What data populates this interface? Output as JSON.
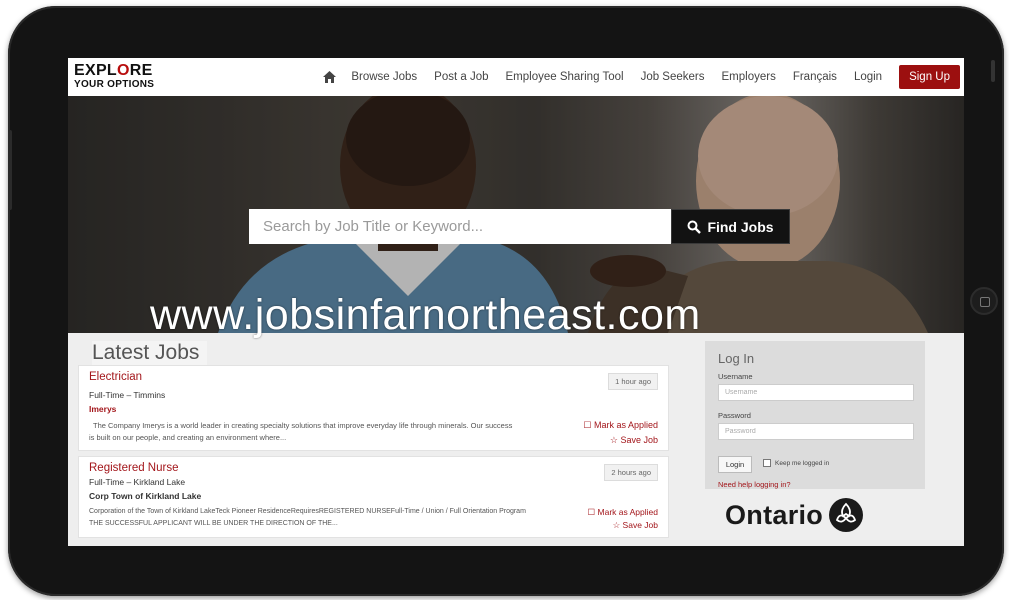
{
  "brand": {
    "line1_a": "EXPL",
    "line1_b": "O",
    "line1_c": "RE",
    "line2": "YOUR OPTIONS",
    "accent_color": "#b80d0d"
  },
  "nav": {
    "home_icon": "home-icon",
    "links": [
      "Browse Jobs",
      "Post a Job",
      "Employee Sharing Tool",
      "Job Seekers",
      "Employers",
      "Français",
      "Login"
    ],
    "signup_label": "Sign Up"
  },
  "hero": {
    "search_placeholder": "Search by Job Title or Keyword...",
    "search_icon": "search-icon",
    "find_label": "Find Jobs"
  },
  "watermark": "www.jobsinfarnortheast.com",
  "latest": {
    "title": "Latest Jobs",
    "jobs": [
      {
        "title": "Electrician",
        "type": "Full-Time – Timmins",
        "company": "Imerys",
        "company_color": "#a3161b",
        "description": "The Company Imerys is a world leader in creating specialty solutions that improve everyday life through minerals. Our success is built on our people, and creating an environment where...",
        "time": "1 hour ago",
        "mark_applied": "Mark as Applied",
        "save": "Save Job"
      },
      {
        "title": "Registered Nurse",
        "type": "Full-Time – Kirkland Lake",
        "company": "Corp Town of Kirkland Lake",
        "company_color": "#333333",
        "description": "Corporation of the Town of Kirkland LakeTeck Pioneer ResidenceRequiresREGISTERED NURSEFull-Time / Union / Full Orientation Program THE SUCCESSFUL APPLICANT WILL BE UNDER THE DIRECTION OF THE...",
        "time": "2 hours ago",
        "mark_applied": "Mark as Applied",
        "save": "Save Job"
      }
    ]
  },
  "login": {
    "title": "Log In",
    "username_label": "Username",
    "username_placeholder": "Username",
    "password_label": "Password",
    "password_placeholder": "Password",
    "button": "Login",
    "keep_logged": "Keep me logged in",
    "help": "Need help logging in?"
  },
  "ontario": {
    "text": "Ontario",
    "logo_icon": "trillium-icon"
  }
}
